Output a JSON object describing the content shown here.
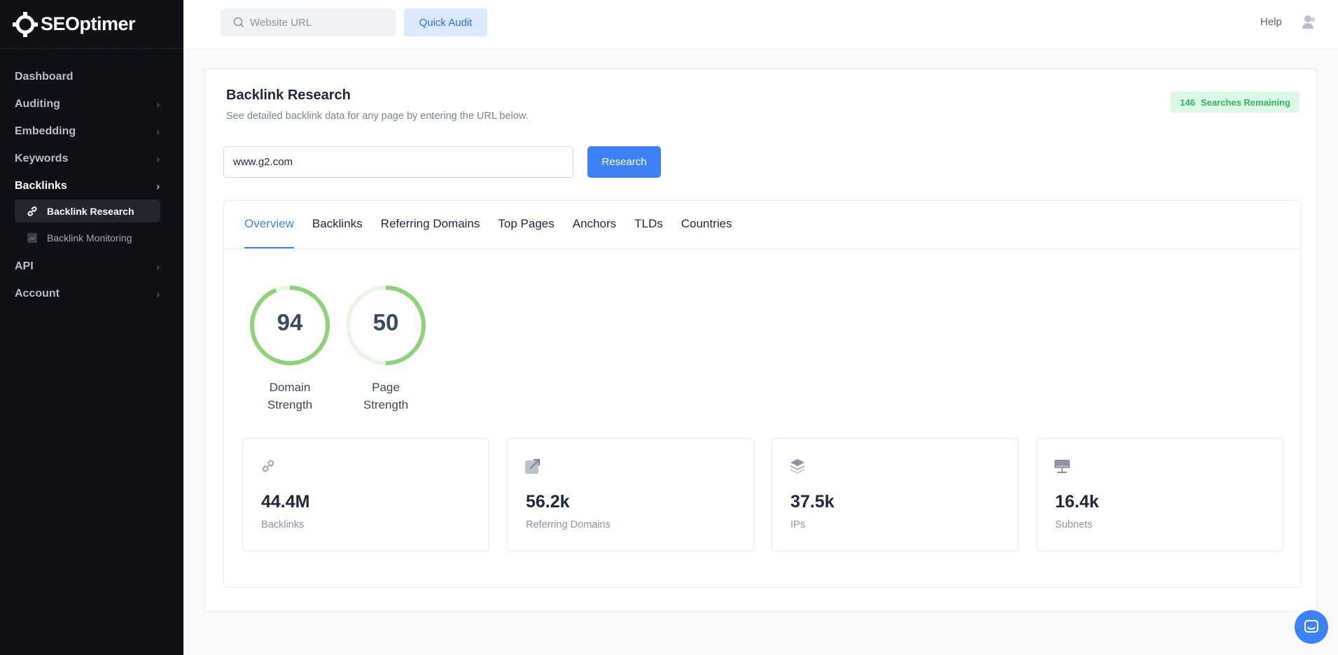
{
  "brand": {
    "name": "SEOptimer"
  },
  "sidebar": {
    "items": [
      {
        "label": "Dashboard",
        "has_chevron": false
      },
      {
        "label": "Auditing",
        "has_chevron": true
      },
      {
        "label": "Embedding",
        "has_chevron": true
      },
      {
        "label": "Keywords",
        "has_chevron": true
      },
      {
        "label": "Backlinks",
        "has_chevron": true,
        "active": true
      },
      {
        "label": "API",
        "has_chevron": true
      },
      {
        "label": "Account",
        "has_chevron": true
      }
    ],
    "subitems": [
      {
        "label": "Backlink Research",
        "icon": "link-icon",
        "active": true
      },
      {
        "label": "Backlink Monitoring",
        "icon": "chart-icon",
        "active": false
      }
    ]
  },
  "topbar": {
    "search_placeholder": "Website URL",
    "quick_audit_label": "Quick Audit",
    "help_label": "Help"
  },
  "main": {
    "title": "Backlink Research",
    "subtitle": "See detailed backlink data for any page by entering the URL below.",
    "remaining_count": "146",
    "remaining_label": "Searches Remaining",
    "url_value": "www.g2.com",
    "research_label": "Research",
    "tabs": [
      "Overview",
      "Backlinks",
      "Referring Domains",
      "Top Pages",
      "Anchors",
      "TLDs",
      "Countries"
    ],
    "active_tab": "Overview",
    "gauges": [
      {
        "value": 94,
        "label_line1": "Domain",
        "label_line2": "Strength",
        "max": 100
      },
      {
        "value": 50,
        "label_line1": "Page",
        "label_line2": "Strength",
        "max": 100
      }
    ],
    "stats": [
      {
        "icon": "link-icon",
        "value": "44.4M",
        "label": "Backlinks"
      },
      {
        "icon": "external-link-icon",
        "value": "56.2k",
        "label": "Referring Domains"
      },
      {
        "icon": "layers-icon",
        "value": "37.5k",
        "label": "IPs"
      },
      {
        "icon": "network-icon",
        "value": "16.4k",
        "label": "Subnets"
      }
    ]
  },
  "colors": {
    "accent": "#3c82f6",
    "gauge_green": "#8fd17c",
    "gauge_track": "#e9f5e5",
    "sidebar_bg": "#0f1117"
  }
}
